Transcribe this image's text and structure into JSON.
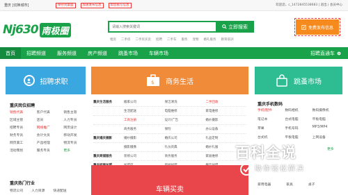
{
  "topbar": {
    "city": "重庆 [切换城市]",
    "links": [
      "保存到桌面",
      "加速发布信息",
      "帮您撰写信息"
    ],
    "welcome": "欢迎您，c_1472845538683 | 退出 | 会员中心"
  },
  "header": {
    "logo_text": "Nj630",
    "logo_cn": "南极圈",
    "search_placeholder": "请输入搜索关键词",
    "search_button": "立即搜索",
    "hotwords": [
      "租房",
      "二手房",
      "二手房买卖",
      "招聘",
      "二手车",
      "服务",
      "宠物",
      "宠物",
      "婚礼服务",
      "教育培训"
    ],
    "publish_button": "免费发布信息"
  },
  "nav": {
    "items": [
      "首页",
      "招聘频道",
      "服务频道",
      "房产频道",
      "跳蚤市场",
      "车辆市场"
    ],
    "active_index": 0,
    "right_label": "招聘直通车"
  },
  "panels": {
    "recruit_title": "招聘求职",
    "business_title": "商务生活",
    "flea_title": "跳蚤市场",
    "recruit2_title": "车辆买卖"
  },
  "recruit": {
    "section_title": "重庆岗位招聘",
    "jobs": [
      "销售代表",
      "客户代表",
      "销售主管",
      "区域主管",
      "店员",
      "人力专员",
      "招聘专员",
      "网络推广",
      "网页设计",
      "财务专员",
      "会计文员",
      "移动开发",
      "网页美工",
      "产品经理",
      "物流专员",
      "活动策划",
      "服务专员",
      "更多"
    ],
    "highlight": [
      "销售代表",
      "网络推广"
    ],
    "section2_title": "重庆热门行业",
    "industries": [
      "物流公司",
      "人力资源",
      "快递配送"
    ]
  },
  "business": {
    "rows": [
      {
        "cat": "重庆生活服务",
        "items": [
          "搬家公司",
          "保洁清洗",
          "二手回收"
        ],
        "hl": 2
      },
      {
        "cat": "",
        "items": [
          "生活配送",
          "电脑维修",
          "家电维修"
        ],
        "hl": -1
      },
      {
        "cat": "",
        "items": [
          "工商注册",
          "设计/广告",
          "婚纱摄影"
        ],
        "hl": 0
      },
      {
        "cat": "",
        "items": [
          "商务服务",
          "保险",
          "办公设备"
        ],
        "hl": -1
      },
      {
        "cat": "重庆婚庆摄影",
        "items": [
          "婚纱摄影",
          "婚庆公司",
          "礼品定制"
        ],
        "hl": -1
      },
      {
        "cat": "",
        "items": [
          "摄影摄像",
          "礼仪庆典",
          "婚纱礼服"
        ],
        "hl": -1
      },
      {
        "cat": "重庆商铺服务",
        "items": [
          "装修公司",
          "商务服务",
          "家居维修"
        ],
        "hl": -1
      },
      {
        "cat": "重庆招商加盟",
        "items": [
          "加盟店",
          "新闻加盟",
          "餐饮加盟"
        ],
        "hl": -1
      },
      {
        "cat": "",
        "items": [
          "投资担保",
          "工商服务",
          "服装加盟"
        ],
        "hl": -1
      },
      {
        "cat": "重庆教育培训",
        "items": [
          "技能培训",
          "家教机构",
          "更多"
        ],
        "hl": -1
      },
      {
        "cat": "重庆宠物服务",
        "items": [
          "宠物用品",
          "宠物店",
          "宠物医院"
        ],
        "hl": -1
      }
    ]
  },
  "flea": {
    "section_title": "重庆手机数码",
    "items": [
      "手机/配件",
      "数码相机",
      "数码摄像机",
      "笔记本",
      "台式电脑",
      "平板电脑",
      "苹果",
      "手机号码",
      "MP3/MP4",
      "台式机",
      "平板电脑",
      "上网设备",
      "数码配件",
      "游戏机",
      "更多"
    ],
    "highlight": [
      "手机/配件"
    ],
    "more_label": "更多",
    "bottom": [
      "家用电器",
      "家具",
      "桌子"
    ]
  },
  "watermark": {
    "title": "百科全说",
    "subtitle": "助你轻松解决"
  },
  "colors": {
    "brand": "#1aa24a",
    "recruit": "#3aa7e1",
    "business": "#f08b3a",
    "flea": "#2ebd92",
    "publish": "#f78a1d"
  }
}
